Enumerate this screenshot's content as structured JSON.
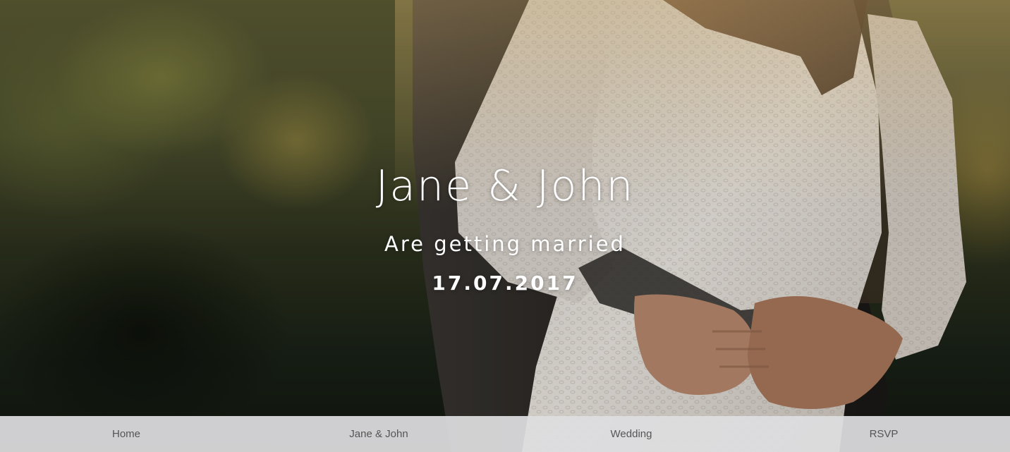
{
  "hero": {
    "title": "Jane & John",
    "tagline": "Are getting married",
    "date": "17.07.2017",
    "image_description_colors": {
      "foliage": "#4a4d2c",
      "dress": "#e6e1db",
      "suit": "#2a2826"
    }
  },
  "nav": {
    "items": [
      {
        "label": "Home"
      },
      {
        "label": "Jane & John"
      },
      {
        "label": "Wedding"
      },
      {
        "label": "RSVP"
      }
    ],
    "background": "#dededf",
    "text_color": "#555555"
  }
}
